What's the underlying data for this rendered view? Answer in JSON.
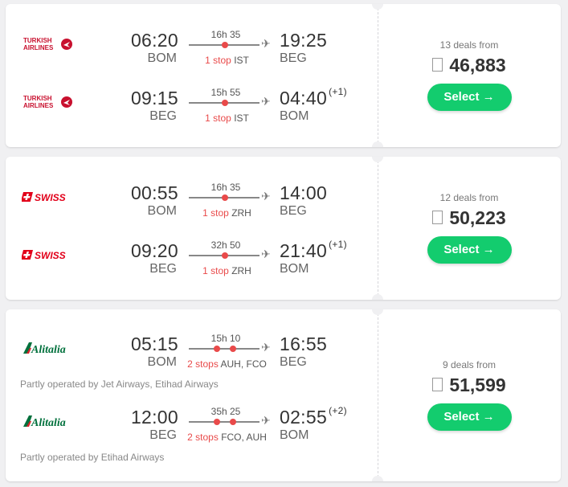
{
  "results": [
    {
      "legs": [
        {
          "airline": "Turkish Airlines",
          "dep_time": "06:20",
          "dep_code": "BOM",
          "arr_time": "19:25",
          "arr_code": "BEG",
          "duration": "16h 35",
          "stops_count": "1 stop",
          "stops_via": "IST",
          "plus_days": "",
          "operated": ""
        },
        {
          "airline": "Turkish Airlines",
          "dep_time": "09:15",
          "dep_code": "BEG",
          "arr_time": "04:40",
          "arr_code": "BOM",
          "duration": "15h 55",
          "stops_count": "1 stop",
          "stops_via": "IST",
          "plus_days": "(+1)",
          "operated": ""
        }
      ],
      "deals": "13 deals from",
      "price": "46,883",
      "select_label": "Select →"
    },
    {
      "legs": [
        {
          "airline": "SWISS",
          "dep_time": "00:55",
          "dep_code": "BOM",
          "arr_time": "14:00",
          "arr_code": "BEG",
          "duration": "16h 35",
          "stops_count": "1 stop",
          "stops_via": "ZRH",
          "plus_days": "",
          "operated": ""
        },
        {
          "airline": "SWISS",
          "dep_time": "09:20",
          "dep_code": "BEG",
          "arr_time": "21:40",
          "arr_code": "BOM",
          "duration": "32h 50",
          "stops_count": "1 stop",
          "stops_via": "ZRH",
          "plus_days": "(+1)",
          "operated": ""
        }
      ],
      "deals": "12 deals from",
      "price": "50,223",
      "select_label": "Select →"
    },
    {
      "legs": [
        {
          "airline": "Alitalia",
          "dep_time": "05:15",
          "dep_code": "BOM",
          "arr_time": "16:55",
          "arr_code": "BEG",
          "duration": "15h 10",
          "stops_count": "2 stops",
          "stops_via": "AUH, FCO",
          "plus_days": "",
          "operated": "Partly operated by Jet Airways, Etihad Airways"
        },
        {
          "airline": "Alitalia",
          "dep_time": "12:00",
          "dep_code": "BEG",
          "arr_time": "02:55",
          "arr_code": "BOM",
          "duration": "35h 25",
          "stops_count": "2 stops",
          "stops_via": "FCO, AUH",
          "plus_days": "(+2)",
          "operated": "Partly operated by Etihad Airways"
        }
      ],
      "deals": "9 deals from",
      "price": "51,599",
      "select_label": "Select →"
    }
  ],
  "logos": {
    "turkish": {
      "line1": "TURKISH",
      "line2": "AIRLINES",
      "color": "#c8102e"
    },
    "swiss": {
      "text": "SWISS",
      "color": "#e2001a"
    },
    "alitalia": {
      "text": "Alitalia",
      "color": "#00703c"
    }
  },
  "colors": {
    "accent": "#13cc6e",
    "stop": "#e94a4a"
  }
}
